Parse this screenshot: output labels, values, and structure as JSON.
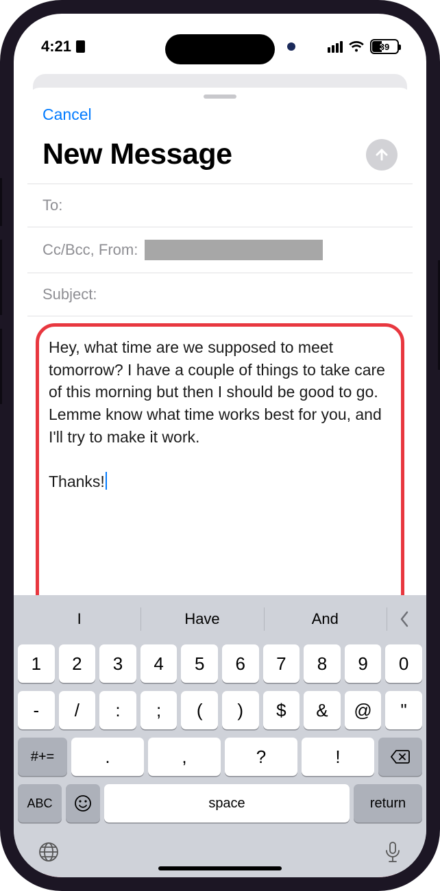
{
  "status": {
    "time": "4:21",
    "battery_percent": "39"
  },
  "sheet": {
    "cancel": "Cancel",
    "title": "New Message",
    "to_label": "To:",
    "ccbcc_label": "Cc/Bcc, From:",
    "subject_label": "Subject:"
  },
  "body": {
    "paragraph": "Hey, what time are we supposed to meet tomorrow? I have a couple of things to take care of this morning but then I should be good to go. Lemme know what time works best for you, and I'll try to make it work.",
    "signoff": "Thanks!"
  },
  "keyboard": {
    "suggestions": [
      "I",
      "Have",
      "And"
    ],
    "row_numbers": [
      "1",
      "2",
      "3",
      "4",
      "5",
      "6",
      "7",
      "8",
      "9",
      "0"
    ],
    "row_sym1": [
      "-",
      "/",
      ":",
      ";",
      "(",
      ")",
      "$",
      "&",
      "@",
      "\""
    ],
    "sym_switch": "#+=",
    "row_punct": [
      ".",
      ",",
      "?",
      "!"
    ],
    "abc": "ABC",
    "space": "space",
    "return": "return"
  }
}
